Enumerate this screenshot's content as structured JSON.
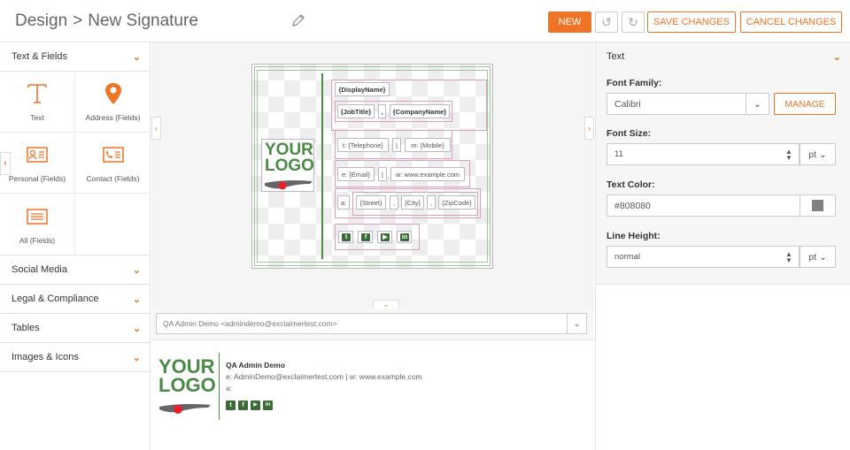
{
  "header": {
    "crumb_root": "Design",
    "crumb_sep": ">",
    "crumb_current": "New Signature",
    "edit_icon": "pencil-icon",
    "new_label": "NEW",
    "undo_icon": "undo-icon",
    "redo_icon": "redo-icon",
    "save_label": "SAVE CHANGES",
    "cancel_label": "CANCEL CHANGES",
    "accent_color": "#f07426"
  },
  "left_panel": {
    "sections": [
      {
        "label": "Text & Fields"
      },
      {
        "label": "Social Media"
      },
      {
        "label": "Legal & Compliance"
      },
      {
        "label": "Tables"
      },
      {
        "label": "Images & Icons"
      }
    ],
    "tiles": [
      {
        "label": "Text",
        "icon": "text-t-icon"
      },
      {
        "label": "Address (Fields)",
        "icon": "map-pin-icon"
      },
      {
        "label": "Personal (Fields)",
        "icon": "id-card-icon"
      },
      {
        "label": "Contact (Fields)",
        "icon": "contact-card-icon"
      },
      {
        "label": "All (Fields)",
        "icon": "list-card-icon"
      }
    ]
  },
  "canvas": {
    "logo_line1": "YOUR",
    "logo_line2": "LOGO",
    "fields": {
      "display_name": "{DisplayName}",
      "job_title": "{JobTitle}",
      "comma1": ",",
      "company_name": "{CompanyName}",
      "telephone": "t: {Telephone}",
      "pipe1": "|",
      "mobile": "m: {Mobile}",
      "email": "e: {Email}",
      "pipe2": "|",
      "website": "w: www.example.com",
      "address_prefix": "a:",
      "street": "{Street}",
      "comma2": ",",
      "city": "{City}",
      "comma3": ",",
      "zip": "{ZipCode}"
    },
    "social_icons": [
      "twitter-icon",
      "facebook-icon",
      "youtube-icon",
      "linkedin-icon"
    ]
  },
  "preview": {
    "user_select": "QA Admin Demo <admindemo@exclaimertest.com>",
    "name": "QA Admin Demo",
    "email_line": "e: AdminDemo@exclaimertest.com",
    "pipe": "|",
    "web_line": "w: www.example.com",
    "address_line": "a:",
    "logo_line1": "YOUR",
    "logo_line2": "LOGO"
  },
  "right_panel": {
    "title": "Text",
    "font_family_label": "Font Family:",
    "font_family_value": "Calibri",
    "manage_label": "MANAGE",
    "font_size_label": "Font Size:",
    "font_size_value": "11",
    "font_size_unit": "pt",
    "text_color_label": "Text Color:",
    "text_color_value": "#808080",
    "line_height_label": "Line Height:",
    "line_height_value": "normal",
    "line_height_unit": "pt",
    "swatch_color": "#808080"
  }
}
